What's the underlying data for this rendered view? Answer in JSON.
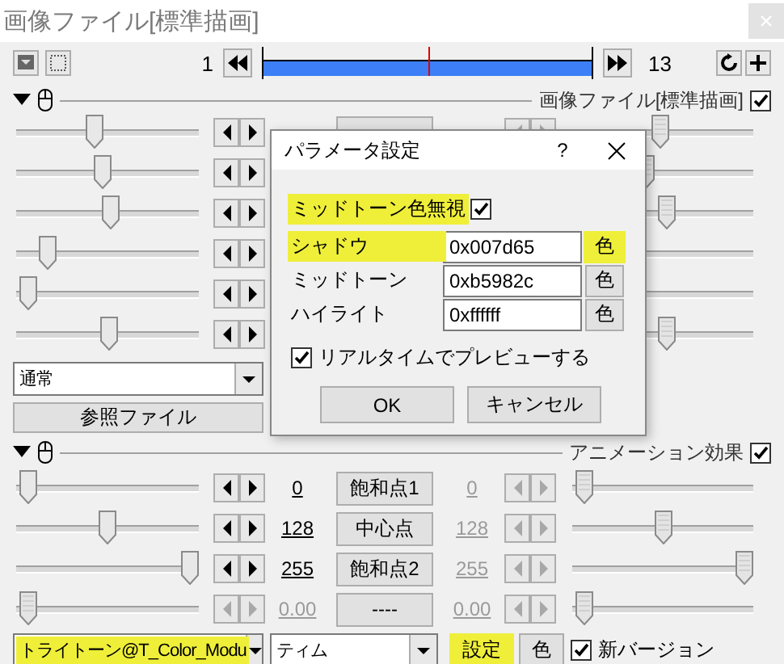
{
  "window": {
    "title": "画像ファイル[標準描画]"
  },
  "toolbar": {
    "start_frame": "1",
    "end_frame": "13",
    "level": 0.5
  },
  "object": {
    "label": "画像ファイル[標準描画]",
    "enabled": true,
    "rows": [
      {
        "left": {
          "level": 0.42,
          "disabled": false
        },
        "right": {
          "level": 0.49,
          "disabled": true
        }
      },
      {
        "left": {
          "level": 0.47,
          "disabled": false
        },
        "right": {
          "level": 0.4,
          "disabled": true
        }
      },
      {
        "left": {
          "level": 0.52,
          "disabled": false
        },
        "right": {
          "level": 0.52,
          "disabled": true
        }
      },
      {
        "left": {
          "level": 0.14,
          "disabled": false
        },
        "right": {}
      },
      {
        "left": {
          "level": 0.02,
          "disabled": false
        },
        "right": {}
      },
      {
        "left": {
          "level": 0.51,
          "disabled": false
        },
        "right": {
          "level": 0.52,
          "disabled": true
        }
      }
    ],
    "blend": {
      "value": "通常"
    },
    "file_button": "参照ファイル"
  },
  "filter": {
    "label": "アニメーション効果",
    "enabled": true,
    "rows": [
      {
        "left": {
          "level": 0.02,
          "disabled": false
        },
        "value": "0",
        "button": "飽和点1",
        "value_2": "0",
        "right": {
          "level": 0.02,
          "disabled": true
        }
      },
      {
        "left": {
          "level": 0.5,
          "disabled": false
        },
        "value": "128",
        "button": "中心点",
        "value_2": "128",
        "right": {
          "level": 0.5,
          "disabled": true
        }
      },
      {
        "left": {
          "level": 1,
          "disabled": false
        },
        "value": "255",
        "button": "飽和点2",
        "value_2": "255",
        "right": {
          "level": 1,
          "disabled": true
        }
      },
      {
        "left": {
          "level": 0.02,
          "disabled": true
        },
        "value": "0.00",
        "button": "----",
        "value_2": "0.00",
        "right": {
          "level": 0.02,
          "disabled": true
        }
      }
    ],
    "effect": {
      "value": "トライトーン@T_Color_Modu",
      "highlighted": true
    },
    "preset": {
      "value": "ティム"
    },
    "settings_button": {
      "label": "設定",
      "highlighted": true
    },
    "color_button": "色",
    "new_version": {
      "label": "新バージョン",
      "checked": true
    }
  },
  "dialog": {
    "title": "パラメータ設定",
    "help": "?",
    "ignore_midtone": {
      "label": "ミッドトーン色無視",
      "checked": true,
      "highlighted": true
    },
    "colors": [
      {
        "label": "シャドウ",
        "value": "0x007d65",
        "button": "色",
        "highlighted": true
      },
      {
        "label": "ミッドトーン",
        "value": "0xb5982c",
        "button": "色",
        "highlighted": false
      },
      {
        "label": "ハイライト",
        "value": "0xffffff",
        "button": "色",
        "highlighted": false
      }
    ],
    "realtime": {
      "label": "リアルタイムでプレビューする",
      "checked": true
    },
    "buttons": [
      "OK",
      "キャンセル"
    ]
  }
}
